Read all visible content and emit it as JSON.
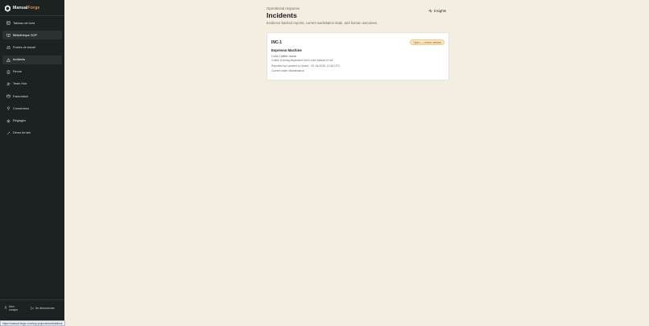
{
  "brand": {
    "part1": "Manual",
    "part2": "Forge"
  },
  "sidebar": {
    "items": [
      {
        "label": "Tableau de bord",
        "icon": "grid-icon"
      },
      {
        "label": "Bibliothèque SOP",
        "icon": "book-icon"
      },
      {
        "label": "Postes de travail",
        "icon": "workstation-icon"
      },
      {
        "label": "Incidents",
        "icon": "alert-triangle-icon"
      },
      {
        "label": "Revue",
        "icon": "clipboard-icon"
      },
      {
        "label": "Team Hub",
        "icon": "users-icon"
      },
      {
        "label": "Facturation",
        "icon": "card-icon"
      },
      {
        "label": "Connexions",
        "icon": "plug-icon"
      },
      {
        "label": "Réglages",
        "icon": "gear-icon"
      },
      {
        "label": "Démo terrain",
        "icon": "wand-icon"
      }
    ],
    "active_index": 3,
    "account_label": "Mon compte",
    "logout_label": "Se déconnecter"
  },
  "header": {
    "eyebrow": "Operational response",
    "title": "Incidents",
    "subtitle": "Evidence-backed reports, current workstation state, and human outcomes.",
    "insights_label": "Insights"
  },
  "incidents": [
    {
      "id": "INC-1",
      "status": "Open — review needed",
      "machine": "Espresso Machine",
      "issue": "Cold Coffee Issue",
      "description": "Coffee is being dispensed but is cold instead of hot",
      "reported": "Reported by Lambert Le Boeuf · 20 Jul 2026, 12:45 UTC",
      "current_state": "Current state: Maintenance"
    }
  ],
  "status_url": "https://manual-forge.com/sop-projects/workstations",
  "colors": {
    "sidebar_bg": "#1c2221",
    "page_bg": "#f4ede2",
    "accent": "#e98b3a",
    "badge_bg": "#fbe7c2"
  }
}
